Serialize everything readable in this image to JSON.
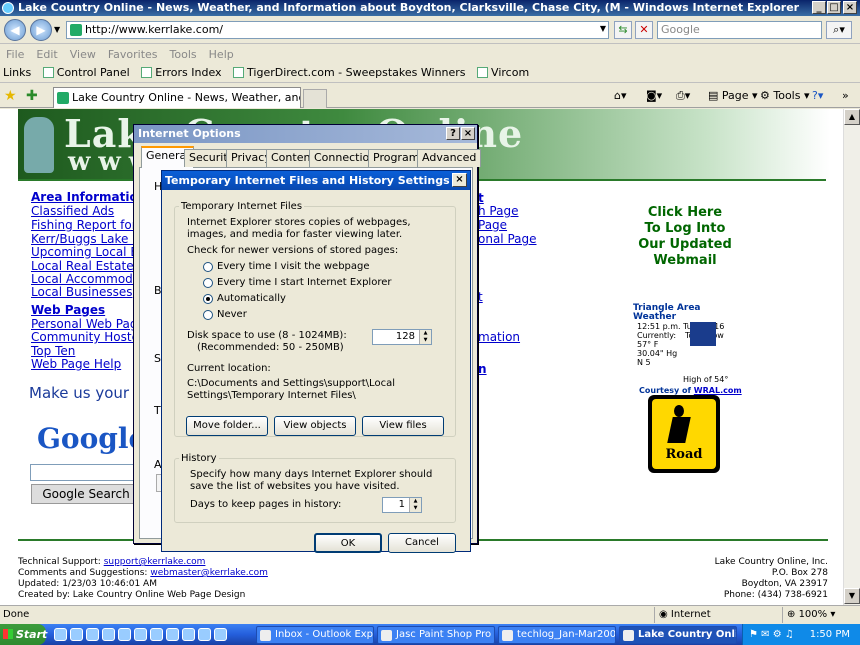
{
  "window": {
    "title": "Lake Country Online - News, Weather, and Information about Boydton, Clarksville, Chase City, (M - Windows Internet Explorer"
  },
  "address": {
    "url": "http://www.kerrlake.com/",
    "search_placeholder": "Google"
  },
  "menu": [
    "File",
    "Edit",
    "View",
    "Favorites",
    "Tools",
    "Help"
  ],
  "links": {
    "label": "Links",
    "items": [
      "Control Panel",
      "Errors Index",
      "TigerDirect.com - Sweepstakes Winners",
      "Vircom"
    ]
  },
  "tab": {
    "title": "Lake Country Online - News, Weather, and Informati..."
  },
  "toolbar": {
    "page": "Page",
    "tools": "Tools"
  },
  "page": {
    "banner_line1": "Lake Country Online",
    "banner_line2": "www",
    "left_links": [
      "Classified Ads",
      "Fishing Report for Ke",
      "Kerr/Buggs Lake Info",
      "Upcoming Local Eve",
      "Local Real Estate Co",
      "Local Accommodatio",
      "Local Businesses"
    ],
    "area_heading": "Area Information",
    "web_heading": "Web Pages",
    "web_links": [
      "Personal Web Pages",
      "Community Hosted W",
      "Top Ten",
      "Web Page Help"
    ],
    "make_us": "Make us your h",
    "google_logo": "Google",
    "google_search": "Google Search",
    "right_fragments": [
      "t",
      "h Page",
      "Page",
      "onal Page",
      "t",
      "mation",
      "n"
    ],
    "webmail": [
      "Click Here",
      "To Log Into",
      "Our Updated",
      "Webmail"
    ],
    "weather": {
      "title": "Triangle Area Weather",
      "time": "12:51 p.m. Tue Jan 16",
      "currently": "Currently:",
      "tomorrow": "Tomorrow",
      "temp": "57° F",
      "pressure": "30.04\" Hg",
      "wind": "N 5",
      "high": "High of 54°",
      "courtesy": "Courtesy of",
      "courtesy_link": "WRAL.com"
    },
    "road_label": "Road",
    "footer_left": {
      "tech": "Technical Support:",
      "tech_email": "support@kerrlake.com",
      "comments": "Comments and Suggestions:",
      "comments_email": "webmaster@kerrlake.com",
      "updated": "Updated: 1/23/03 10:46:01 AM",
      "created": "Created by: Lake Country Online Web Page Design"
    },
    "footer_right": {
      "name": "Lake Country Online, Inc.",
      "box": "P.O. Box 278",
      "city": "Boydton, VA 23917",
      "phone": "Phone: (434) 738-6921"
    }
  },
  "internet_options": {
    "title": "Internet Options",
    "tabs": [
      "General",
      "Security",
      "Privacy",
      "Content",
      "Connections",
      "Programs",
      "Advanced"
    ],
    "stub_letters": [
      "H",
      "B",
      "S",
      "T",
      "A"
    ]
  },
  "temp_files": {
    "title": "Temporary Internet Files and History Settings",
    "group1": "Temporary Internet Files",
    "desc": "Internet Explorer stores copies of webpages, images, and media for faster viewing later.",
    "check_label": "Check for newer versions of stored pages:",
    "options": [
      "Every time I visit the webpage",
      "Every time I start Internet Explorer",
      "Automatically",
      "Never"
    ],
    "selected_option": "Automatically",
    "disk_label": "Disk space to use (8 - 1024MB):",
    "disk_recommended": "(Recommended: 50 - 250MB)",
    "disk_value": "128",
    "location_label": "Current location:",
    "location_path": "C:\\Documents and Settings\\support\\Local Settings\\Temporary Internet Files\\",
    "buttons": [
      "Move folder...",
      "View objects",
      "View files"
    ],
    "group2": "History",
    "history_desc": "Specify how many days Internet Explorer should save the list of websites you have visited.",
    "days_label": "Days to keep pages in history:",
    "days_value": "1",
    "ok": "OK",
    "cancel": "Cancel"
  },
  "status": {
    "text": "Done",
    "zone": "Internet",
    "zoom": "100%"
  },
  "taskbar": {
    "start": "Start",
    "tasks": [
      "Inbox - Outlook Expr...",
      "Jasc Paint Shop Pro -...",
      "techlog_Jan-Mar200...",
      "Lake Country Onli..."
    ],
    "clock": "1:50 PM"
  }
}
